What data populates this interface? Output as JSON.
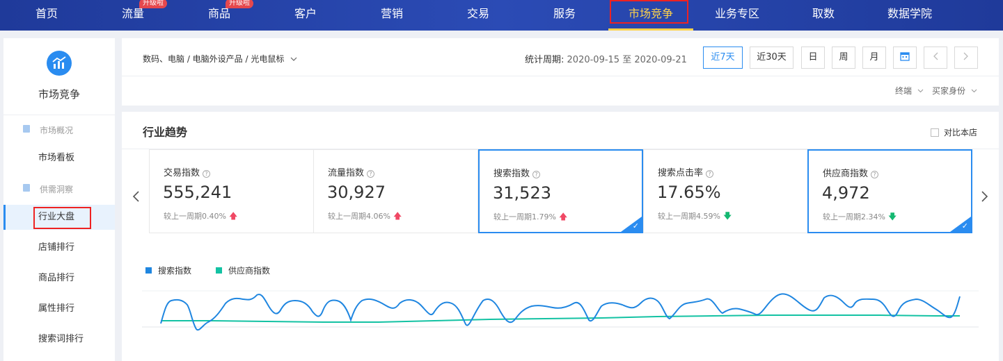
{
  "nav": {
    "items": [
      {
        "label": "首页"
      },
      {
        "label": "流量",
        "badge": "升级啦"
      },
      {
        "label": "商品",
        "badge": "升级啦"
      },
      {
        "label": "客户"
      },
      {
        "label": "营销"
      },
      {
        "label": "交易"
      },
      {
        "label": "服务"
      },
      {
        "label": "市场竞争",
        "active": true
      },
      {
        "label": "业务专区"
      },
      {
        "label": "取数"
      },
      {
        "label": "数据学院"
      }
    ]
  },
  "sidebar": {
    "title": "市场竞争",
    "groups": [
      {
        "label": "市场概况",
        "items": [
          "市场看板"
        ]
      },
      {
        "label": "供需洞察",
        "items": [
          "行业大盘",
          "店铺排行",
          "商品排行",
          "属性排行",
          "搜索词排行"
        ]
      }
    ],
    "active_item": "行业大盘"
  },
  "filter": {
    "breadcrumb": "数码、电脑 / 电脑外设产品 / 光电鼠标",
    "period_label": "统计周期:",
    "period_dates": "2020-09-15 至 2020-09-21",
    "buttons": [
      "近7天",
      "近30天",
      "日",
      "周",
      "月"
    ],
    "selected_button": "近7天",
    "dropdowns": [
      "终端",
      "买家身份"
    ]
  },
  "trend": {
    "title": "行业趋势",
    "compare_label": "对比本店",
    "cards": [
      {
        "label": "交易指数",
        "value": "555,241",
        "compare": "较上一周期0.40%",
        "dir": "up",
        "selected": false
      },
      {
        "label": "流量指数",
        "value": "30,927",
        "compare": "较上一周期4.06%",
        "dir": "up",
        "selected": false
      },
      {
        "label": "搜索指数",
        "value": "31,523",
        "compare": "较上一周期1.79%",
        "dir": "up",
        "selected": true
      },
      {
        "label": "搜索点击率",
        "value": "17.65%",
        "compare": "较上一周期4.59%",
        "dir": "down",
        "selected": false
      },
      {
        "label": "供应商指数",
        "value": "4,972",
        "compare": "较上一周期2.34%",
        "dir": "down",
        "selected": true
      }
    ],
    "legend": [
      {
        "name": "搜索指数",
        "color": "#1f86e0"
      },
      {
        "name": "供应商指数",
        "color": "#13c2a3"
      }
    ],
    "icons": {
      "up": "arrow-up-icon",
      "down": "arrow-down-icon",
      "prev": "chevron-left-icon",
      "next": "chevron-right-icon",
      "calendar": "calendar-icon"
    }
  }
}
